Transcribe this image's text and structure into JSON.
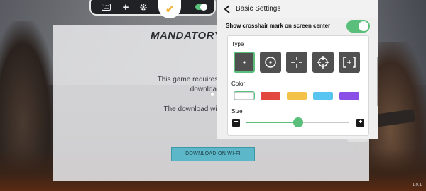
{
  "game_dialog": {
    "title": "MANDATORY CONTEN",
    "message_line1": "This game requires a mandatory c",
    "message_line2": "download the",
    "message_line3": "The download will be paused i",
    "download_button": "DOWNLOAD ON WI-FI"
  },
  "toolbar": {
    "icons": [
      "keyboard-icon",
      "plus-icon",
      "gear-icon",
      "toggle-icon",
      "check-icon"
    ],
    "check_glyph": "✔",
    "plus_glyph": "+",
    "toggle_on": true
  },
  "settings": {
    "title": "Basic Settings",
    "crosshair_label": "Show crosshair mark on screen center",
    "crosshair_enabled": true,
    "type_label": "Type",
    "types": [
      "dot",
      "circle-dot",
      "cross-gap",
      "scope",
      "bracket-plus"
    ],
    "selected_type": 0,
    "color_label": "Color",
    "colors": [
      "#ffffff",
      "#e34840",
      "#f4c248",
      "#58c4f0",
      "#8a4fe6"
    ],
    "selected_color": 0,
    "size_label": "Size",
    "size_value": 0.5,
    "minus_glyph": "−",
    "plus_glyph": "+"
  },
  "accent_color": "#5abf7a",
  "version": "1.0.1"
}
